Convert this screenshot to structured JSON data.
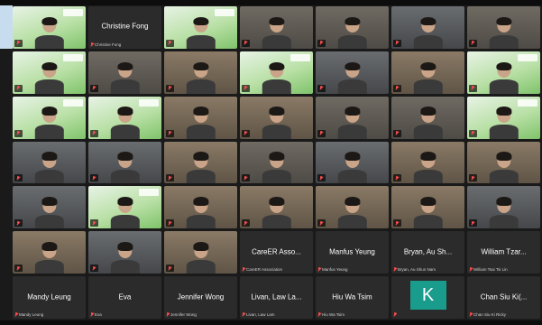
{
  "window": {
    "left_strip_color": "#c8dcf0"
  },
  "tiles": [
    {
      "kind": "branded",
      "name": "",
      "center": ""
    },
    {
      "kind": "dark",
      "name": "Christine Fong",
      "center": "Christine Fong"
    },
    {
      "kind": "branded",
      "name": "",
      "center": ""
    },
    {
      "kind": "video",
      "name": "",
      "center": ""
    },
    {
      "kind": "video",
      "name": "",
      "center": ""
    },
    {
      "kind": "dim",
      "name": "",
      "center": ""
    },
    {
      "kind": "video",
      "name": "",
      "center": ""
    },
    {
      "kind": "branded",
      "name": "",
      "center": ""
    },
    {
      "kind": "video",
      "name": "",
      "center": ""
    },
    {
      "kind": "room",
      "name": "",
      "center": ""
    },
    {
      "kind": "branded",
      "name": "",
      "center": ""
    },
    {
      "kind": "dim",
      "name": "",
      "center": ""
    },
    {
      "kind": "room",
      "name": "",
      "center": ""
    },
    {
      "kind": "branded",
      "name": "",
      "center": ""
    },
    {
      "kind": "branded",
      "name": "",
      "center": ""
    },
    {
      "kind": "branded",
      "name": "",
      "center": ""
    },
    {
      "kind": "room",
      "name": "",
      "center": ""
    },
    {
      "kind": "room",
      "name": "",
      "center": ""
    },
    {
      "kind": "video",
      "name": "",
      "center": ""
    },
    {
      "kind": "video",
      "name": "",
      "center": ""
    },
    {
      "kind": "branded",
      "name": "",
      "center": ""
    },
    {
      "kind": "dim",
      "name": "",
      "center": ""
    },
    {
      "kind": "dim",
      "name": "",
      "center": ""
    },
    {
      "kind": "room",
      "name": "",
      "center": ""
    },
    {
      "kind": "video",
      "name": "",
      "center": ""
    },
    {
      "kind": "dim",
      "name": "",
      "center": ""
    },
    {
      "kind": "room",
      "name": "",
      "center": ""
    },
    {
      "kind": "room",
      "name": "",
      "center": ""
    },
    {
      "kind": "dim",
      "name": "",
      "center": ""
    },
    {
      "kind": "branded",
      "name": "",
      "center": ""
    },
    {
      "kind": "room",
      "name": "",
      "center": ""
    },
    {
      "kind": "room",
      "name": "",
      "center": ""
    },
    {
      "kind": "room",
      "name": "",
      "center": ""
    },
    {
      "kind": "room",
      "name": "",
      "center": ""
    },
    {
      "kind": "dim",
      "name": "",
      "center": ""
    },
    {
      "kind": "room",
      "name": "",
      "center": ""
    },
    {
      "kind": "dim",
      "name": "",
      "center": ""
    },
    {
      "kind": "room",
      "name": "",
      "center": ""
    },
    {
      "kind": "dark",
      "name": "CareER Association",
      "center": "CareER Asso..."
    },
    {
      "kind": "dark",
      "name": "Manfus Yeung",
      "center": "Manfus Yeung"
    },
    {
      "kind": "dark",
      "name": "Bryan, Au Shun Nam",
      "center": "Bryan, Au Sh..."
    },
    {
      "kind": "dark",
      "name": "William Tsai Tsi Lin",
      "center": "William Tzar..."
    },
    {
      "kind": "dark",
      "name": "Mandy Leung",
      "center": "Mandy Leung"
    },
    {
      "kind": "dark",
      "name": "Eva",
      "center": "Eva"
    },
    {
      "kind": "dark",
      "name": "Jennifer Wong",
      "center": "Jennifer Wong"
    },
    {
      "kind": "dark",
      "name": "Livan, Law Lam",
      "center": "Livan, Law La..."
    },
    {
      "kind": "dark",
      "name": "Hiu Wa Tsim",
      "center": "Hiu Wa Tsim"
    },
    {
      "kind": "avatar",
      "name": "",
      "center": "K"
    },
    {
      "kind": "dark",
      "name": "Chan Siu Ki Ricky",
      "center": "Chan Siu Ki(..."
    }
  ]
}
